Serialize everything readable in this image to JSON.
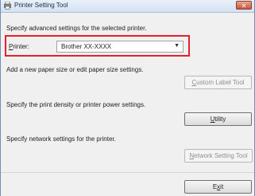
{
  "window": {
    "title": "Printer Setting Tool",
    "close_label": "✕"
  },
  "header": {
    "instruction": "Specify advanced settings for the selected printer."
  },
  "printer": {
    "label": "Printer:",
    "label_access_key": "P",
    "label_rest": "rinter:",
    "selected": "Brother XX-XXXX"
  },
  "sections": {
    "paper": {
      "text": "Add a new paper size or edit paper size settings.",
      "button_key": "C",
      "button_rest": "ustom Label Tool"
    },
    "utility": {
      "text": "Specify the print density or printer power settings.",
      "button_key": "U",
      "button_rest": "tility"
    },
    "network": {
      "text": "Specify network settings for the printer.",
      "button_key": "N",
      "button_rest": "etwork Setting Tool"
    }
  },
  "footer": {
    "exit_pre": "E",
    "exit_key": "x",
    "exit_post": "it"
  },
  "colors": {
    "highlight": "#e4202e",
    "disabled_text": "#8f8f8f"
  }
}
